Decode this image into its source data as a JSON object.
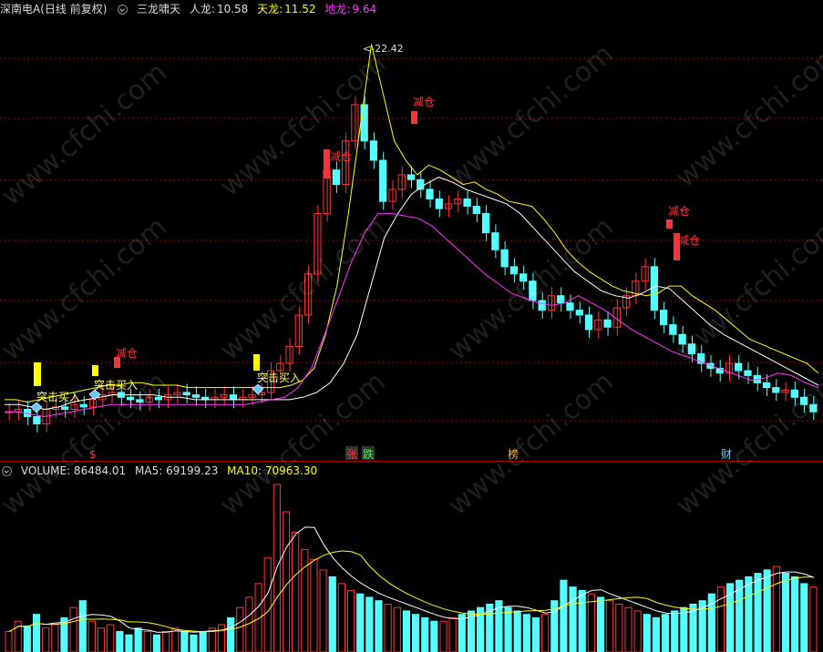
{
  "header": {
    "stock": "深南电A(日线 前复权)",
    "indicator": "三龙啸天",
    "renlong": {
      "label": "人龙:",
      "value": "10.58",
      "color": "#dddddd"
    },
    "tianlong": {
      "label": "天龙:",
      "value": "11.52",
      "color": "#ffff00"
    },
    "dilong": {
      "label": "地龙:",
      "value": "9.64",
      "color": "#ff33ff"
    }
  },
  "volume_header": {
    "volume": "VOLUME: 86484.01",
    "ma5": "MA5: 69199.23",
    "ma10": "MA10: 70963.30"
  },
  "annotations": {
    "high_price": "22.42",
    "reduce": "减仓",
    "buy": "突击买入"
  },
  "markers": {
    "dollar": "$",
    "zhang": "张",
    "die": "跌",
    "bang": "榜",
    "cai": "财"
  },
  "watermark": "www.cfchi.com",
  "colors": {
    "up": "#ff3333",
    "down": "#54ffff",
    "tianlong": "#ffff00",
    "renlong": "#ffffff",
    "dilong": "#ff33ff",
    "grid": "#aa0000"
  },
  "chart_data": {
    "type": "candlestick",
    "ylim": [
      6.0,
      24.0
    ],
    "close": [
      7.8,
      7.9,
      7.6,
      7.3,
      7.9,
      8.0,
      7.9,
      8.1,
      8.0,
      8.3,
      8.5,
      8.6,
      8.4,
      8.3,
      8.2,
      8.4,
      8.3,
      8.5,
      8.6,
      8.5,
      8.4,
      8.3,
      8.4,
      8.5,
      8.3,
      8.4,
      8.5,
      8.6,
      9.5,
      9.8,
      10.5,
      11.8,
      13.5,
      16.0,
      17.8,
      17.2,
      19.0,
      20.5,
      19.0,
      18.2,
      16.5,
      17.0,
      17.6,
      17.4,
      17.0,
      16.6,
      16.2,
      16.4,
      16.6,
      16.3,
      16.0,
      15.2,
      14.5,
      13.8,
      13.5,
      13.2,
      12.4,
      12.0,
      12.6,
      12.3,
      12.0,
      11.8,
      11.2,
      11.6,
      11.3,
      12.1,
      12.6,
      13.2,
      13.8,
      12.0,
      11.4,
      11.0,
      10.6,
      10.2,
      9.8,
      9.6,
      9.4,
      9.8,
      9.5,
      9.3,
      9.0,
      8.8,
      8.6,
      8.7,
      8.4,
      8.1,
      7.8
    ],
    "tianlong": [
      8.3,
      8.3,
      8.2,
      8.3,
      8.4,
      8.5,
      8.6,
      8.7,
      8.8,
      8.9,
      8.9,
      9.0,
      9.0,
      8.9,
      8.9,
      8.9,
      8.8,
      8.8,
      8.8,
      8.8,
      8.8,
      8.8,
      8.8,
      8.8,
      8.8,
      8.9,
      9.1,
      9.6,
      11.0,
      13.0,
      16.0,
      19.5,
      23.0,
      21.0,
      19.0,
      18.2,
      17.6,
      18.0,
      17.8,
      17.5,
      17.2,
      17.3,
      17.0,
      16.8,
      16.5,
      16.4,
      16.3,
      15.8,
      15.2,
      14.5,
      14.0,
      13.6,
      13.3,
      13.0,
      12.8,
      12.7,
      12.6,
      12.7,
      13.0,
      13.0,
      12.6,
      12.3,
      12.0,
      11.6,
      11.2,
      10.8,
      10.6,
      10.4,
      10.2,
      10.0,
      9.8,
      9.4
    ],
    "renlong": [
      8.1,
      8.1,
      8.0,
      7.9,
      8.0,
      8.2,
      8.3,
      8.4,
      8.5,
      8.5,
      8.5,
      8.5,
      8.4,
      8.4,
      8.3,
      8.3,
      8.3,
      8.3,
      8.3,
      8.3,
      8.3,
      8.3,
      8.4,
      8.6,
      9.0,
      9.8,
      11.0,
      13.0,
      15.0,
      16.0,
      16.8,
      17.2,
      17.5,
      17.3,
      17.0,
      16.8,
      16.6,
      16.4,
      16.0,
      15.4,
      14.8,
      14.2,
      13.6,
      13.2,
      12.8,
      12.6,
      12.5,
      12.7,
      13.0,
      12.9,
      12.4,
      11.9,
      11.4,
      11.0,
      10.7,
      10.4,
      10.1,
      9.8,
      9.5,
      9.2,
      8.9
    ],
    "dilong": [
      7.8,
      7.8,
      7.7,
      7.6,
      7.7,
      7.8,
      7.9,
      8.0,
      8.1,
      8.1,
      8.1,
      8.1,
      8.1,
      8.1,
      8.1,
      8.1,
      8.1,
      8.1,
      8.1,
      8.2,
      8.3,
      8.4,
      8.8,
      9.6,
      11.0,
      12.5,
      14.0,
      15.2,
      16.0,
      16.0,
      15.9,
      15.8,
      15.5,
      15.0,
      14.5,
      14.0,
      13.5,
      13.1,
      12.7,
      12.5,
      12.3,
      12.2,
      12.3,
      12.6,
      12.3,
      12.0,
      11.6,
      11.2,
      10.9,
      10.6,
      10.3,
      10.1,
      9.9,
      9.7,
      9.5,
      9.3,
      9.1,
      9.2,
      9.4,
      9.3,
      9.0,
      8.8
    ],
    "volume": [
      12,
      18,
      15,
      22,
      14,
      16,
      20,
      26,
      30,
      18,
      14,
      16,
      12,
      10,
      14,
      12,
      10,
      12,
      14,
      12,
      10,
      12,
      14,
      16,
      20,
      26,
      32,
      40,
      55,
      98,
      82,
      70,
      60,
      54,
      48,
      44,
      40,
      36,
      34,
      32,
      30,
      28,
      26,
      24,
      22,
      20,
      18,
      18,
      20,
      22,
      24,
      26,
      28,
      30,
      26,
      24,
      22,
      20,
      22,
      30,
      42,
      38,
      36,
      34,
      32,
      30,
      28,
      26,
      24,
      22,
      20,
      22,
      24,
      26,
      28,
      30,
      34,
      38,
      40,
      42,
      44,
      46,
      48,
      50,
      46,
      44,
      40,
      38
    ]
  }
}
